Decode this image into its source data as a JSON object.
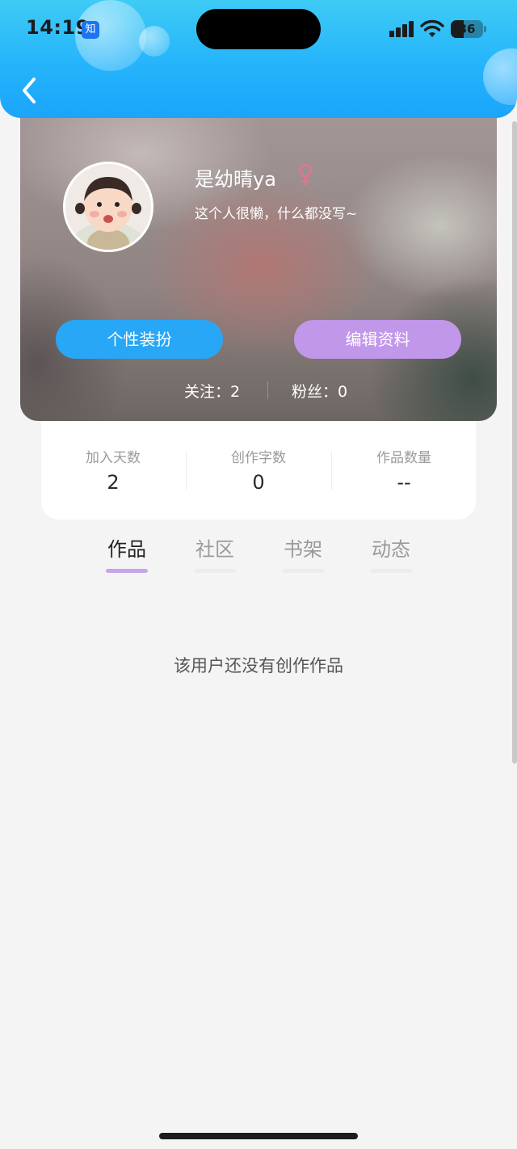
{
  "status_bar": {
    "time": "14:19",
    "app_badge": "知",
    "battery_level": "36",
    "battery_percent": 36,
    "icons": [
      "signal-icon",
      "wifi-icon",
      "battery-icon"
    ]
  },
  "header": {
    "back_icon": "chevron-left-icon",
    "gradient_colors": [
      "#3ecbf5",
      "#1aa5fb"
    ]
  },
  "profile": {
    "username": "是幼晴ya",
    "gender_icon": "female-icon",
    "gender_color": "#e3758d",
    "bio": "这个人很懒，什么都没写~",
    "buttons": {
      "decorate_label": "个性装扮",
      "decorate_color": "#27a7f6",
      "edit_label": "编辑资料",
      "edit_color": "#c197ea"
    },
    "following": "关注：2",
    "followers": "粉丝：0"
  },
  "stats": [
    {
      "label": "加入天数",
      "value": "2"
    },
    {
      "label": "创作字数",
      "value": "0"
    },
    {
      "label": "作品数量",
      "value": "--"
    }
  ],
  "tabs": [
    {
      "label": "作品",
      "active": true
    },
    {
      "label": "社区",
      "active": false
    },
    {
      "label": "书架",
      "active": false
    },
    {
      "label": "动态",
      "active": false
    }
  ],
  "empty_message": "该用户还没有创作作品",
  "accent_colors": {
    "tab_underline_active": "#c4a6ea",
    "page_background": "#f4f4f4"
  }
}
